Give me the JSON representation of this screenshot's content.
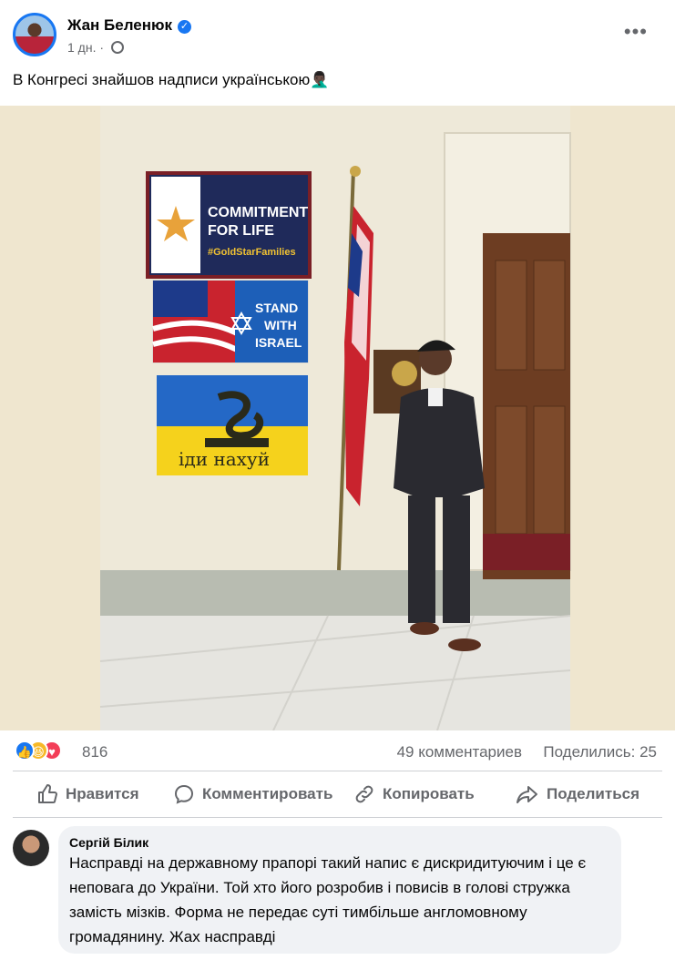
{
  "post": {
    "author": "Жан Беленюк",
    "time": "1 дн.",
    "text": "В Конгресі знайшов надписи українською🤦🏿‍♂️",
    "photo_signs": {
      "sign1_line1": "COMMITMENT",
      "sign1_line2": "FOR LIFE",
      "sign1_hashtag": "#GoldStarFamilies",
      "sign2_line1": "STAND",
      "sign2_line2": "WITH",
      "sign2_line3": "ISRAEL",
      "sign3_text": "іди нахуй"
    }
  },
  "stats": {
    "reactions_count": "816",
    "comments": "49 комментариев",
    "shares": "Поделились: 25"
  },
  "actions": {
    "like": "Нравится",
    "comment": "Комментировать",
    "copy": "Копировать",
    "share": "Поделиться"
  },
  "comment": {
    "author": "Сергій Білик",
    "text": "Насправді на державному прапорі такий напис є дискридитуючим і це є неповага до України. Той хто його розробив і повисів в голові стружка замість мізків. Форма не передає суті тимбільше англомовному громадянину. Жах насправді"
  },
  "colors": {
    "accent": "#1877f2",
    "secondary_text": "#65676b",
    "bubble": "#f0f2f5"
  }
}
